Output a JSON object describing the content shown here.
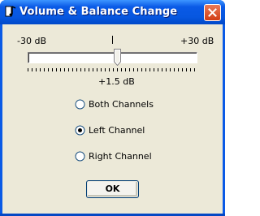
{
  "window": {
    "title": "Volume & Balance Change",
    "app_icon": "music-note-icon",
    "close_icon": "close-icon"
  },
  "slider": {
    "min_label": "-30 dB",
    "max_label": "+30 dB",
    "value_label": "+1.5 dB",
    "min": -30,
    "max": 30,
    "value": 1.5
  },
  "channels": {
    "options": [
      {
        "label": "Both Channels",
        "selected": false
      },
      {
        "label": "Left Channel",
        "selected": true
      },
      {
        "label": "Right Channel",
        "selected": false
      }
    ]
  },
  "buttons": {
    "ok_label": "OK"
  },
  "colors": {
    "titlebar": "#0a5ae6",
    "dialog_bg": "#ece9d8",
    "close_button": "#d23d14",
    "button_border": "#003c74"
  }
}
